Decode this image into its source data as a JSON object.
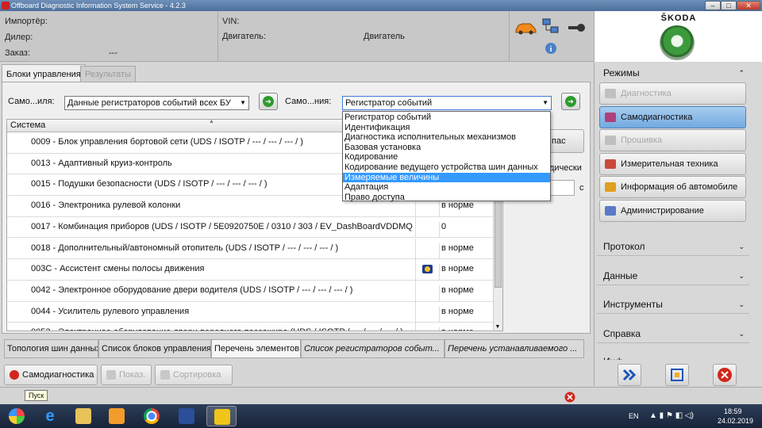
{
  "window": {
    "title": "Offboard Diagnostic Information System Service - 4.2.3"
  },
  "header": {
    "importer_label": "Импортёр:",
    "dealer_label": "Дилер:",
    "order_label": "Заказ:",
    "order_value": "---",
    "vin_label": "VIN:",
    "engine_label": "Двигатель:",
    "engine_label2": "Двигатель"
  },
  "brand": {
    "name": "ŠKODA",
    "logo": "skoda-logo"
  },
  "tabs": [
    {
      "label": "Блоки управления",
      "active": true
    },
    {
      "label": "Результаты",
      "active": false
    }
  ],
  "filters": {
    "label1": "Само...иля:",
    "value1": "Данные регистраторов событий всех БУ",
    "label2": "Само...ния:",
    "value2": "Регистратор событий"
  },
  "dropdown": {
    "options": [
      "Регистратор событий",
      "Идентификация",
      "Диагностика исполнительных механизмов",
      "Базовая установка",
      "Кодирование",
      "Кодирование ведущего устройства шин данных",
      "Измеряемые величины",
      "Адаптация",
      "Право доступа"
    ],
    "selected_index": 6
  },
  "table": {
    "header": "Система",
    "rows": [
      {
        "system": "0009 - Блок управления бортовой сети  (UDS / ISOTP / --- / --- / --- / )",
        "status": ""
      },
      {
        "system": "0013 - Адаптивный круиз-контроль",
        "status": ""
      },
      {
        "system": "0015 - Подушки безопасности  (UDS / ISOTP / --- / --- / --- / )",
        "status": ""
      },
      {
        "system": "0016 - Электроника рулевой колонки",
        "status": "в норме"
      },
      {
        "system": "0017 - Комбинация приборов  (UDS / ISOTP / 5E0920750E / 0310 / 303 / EV_DashBoardVDDMQ",
        "status": "0"
      },
      {
        "system": "0018 - Дополнительный/автономный отопитель  (UDS / ISOTP / --- / --- / --- / )",
        "status": "в норме"
      },
      {
        "system": "003C - Ассистент смены полосы движения",
        "status": "в норме",
        "has_icon": true
      },
      {
        "system": "0042 - Электронное оборудование двери водителя  (UDS / ISOTP / --- / --- / --- / )",
        "status": "в норме"
      },
      {
        "system": "0044 - Усилитель рулевого управления",
        "status": "в норме"
      },
      {
        "system": "0052 - Электронное оборудование двери переднего пассажира  (UDS / ISOTP / --- / --- / --- / )",
        "status": "в норме"
      }
    ]
  },
  "side_fragments": {
    "btn_text": "пас",
    "label_text": "дически",
    "field_suffix": "с"
  },
  "bottom_tabs": [
    {
      "label": "Топология шин данных",
      "active": false,
      "italic": false
    },
    {
      "label": "Список блоков управления",
      "active": false,
      "italic": false
    },
    {
      "label": "Перечень элементов",
      "active": true,
      "italic": false
    },
    {
      "label": "Список регистраторов событ...",
      "active": false,
      "italic": true
    },
    {
      "label": "Перечень устанавливаемого ...",
      "active": false,
      "italic": true
    }
  ],
  "actions": [
    {
      "label": "Самодиагностика",
      "enabled": true
    },
    {
      "label": "Показ.",
      "enabled": false
    },
    {
      "label": "Сортировка",
      "enabled": false
    }
  ],
  "sidebar": {
    "modes_title": "Режимы",
    "modes": [
      {
        "label": "Диагностика",
        "enabled": false,
        "active": false
      },
      {
        "label": "Самодиагностика",
        "enabled": true,
        "active": true
      },
      {
        "label": "Прошивка",
        "enabled": false,
        "active": false
      },
      {
        "label": "Измерительная техника",
        "enabled": true,
        "active": false
      },
      {
        "label": "Информация об автомобиле",
        "enabled": true,
        "active": false
      },
      {
        "label": "Администрирование",
        "enabled": true,
        "active": false
      }
    ],
    "sections": [
      "Протокол",
      "Данные",
      "Инструменты",
      "Справка",
      "Инф..."
    ]
  },
  "tooltip": "Пуск",
  "taskbar": {
    "lang": "EN",
    "time": "18:59",
    "date": "24.02.2019"
  },
  "colors": {
    "accent": "#3399ff",
    "active_mode": "#73a9df",
    "green": "#2e9a2e",
    "red": "#d0281c"
  }
}
